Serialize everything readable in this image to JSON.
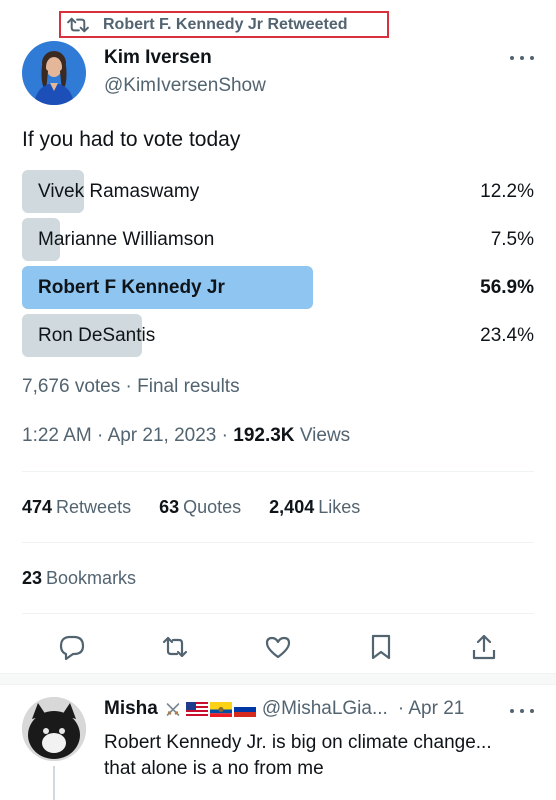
{
  "retweet_banner": {
    "text": "Robert F. Kennedy Jr Retweeted",
    "icon": "retweet-icon"
  },
  "author": {
    "name": "Kim Iversen",
    "handle": "@KimIversenShow"
  },
  "tweet": {
    "text": "If you had to vote today"
  },
  "poll": {
    "options": [
      {
        "label": "Vivek Ramaswamy",
        "percent": "12.2%",
        "share": 0.122,
        "winner": false
      },
      {
        "label": "Marianne Williamson",
        "percent": "7.5%",
        "share": 0.075,
        "winner": false
      },
      {
        "label": "Robert F Kennedy Jr",
        "percent": "56.9%",
        "share": 0.569,
        "winner": true
      },
      {
        "label": "Ron DeSantis",
        "percent": "23.4%",
        "share": 0.234,
        "winner": false
      }
    ],
    "votes": "7,676 votes",
    "status": "Final results"
  },
  "meta": {
    "time": "1:22 AM",
    "date": "Apr 21, 2023",
    "views_count": "192.3K",
    "views_label": "Views"
  },
  "stats": {
    "retweets_count": "474",
    "retweets_label": "Retweets",
    "quotes_count": "63",
    "quotes_label": "Quotes",
    "likes_count": "2,404",
    "likes_label": "Likes",
    "bookmarks_count": "23",
    "bookmarks_label": "Bookmarks"
  },
  "actions": [
    "reply-icon",
    "retweet-icon",
    "like-icon",
    "bookmark-icon",
    "share-icon"
  ],
  "reply": {
    "name": "Misha",
    "handle": "@MishaLGia...",
    "date": "· Apr 21",
    "text": "Robert Kennedy Jr. is big on climate change... that alone is a no from me",
    "emoji": [
      "crossed-swords",
      "us-flag",
      "ecuador-flag",
      "russia-flag"
    ]
  },
  "colors": {
    "text": "#0f1419",
    "secondary": "#536471",
    "poll_bar": "#cfd9de",
    "poll_winner": "#8ec5f1",
    "highlight_border": "#d9303e"
  }
}
